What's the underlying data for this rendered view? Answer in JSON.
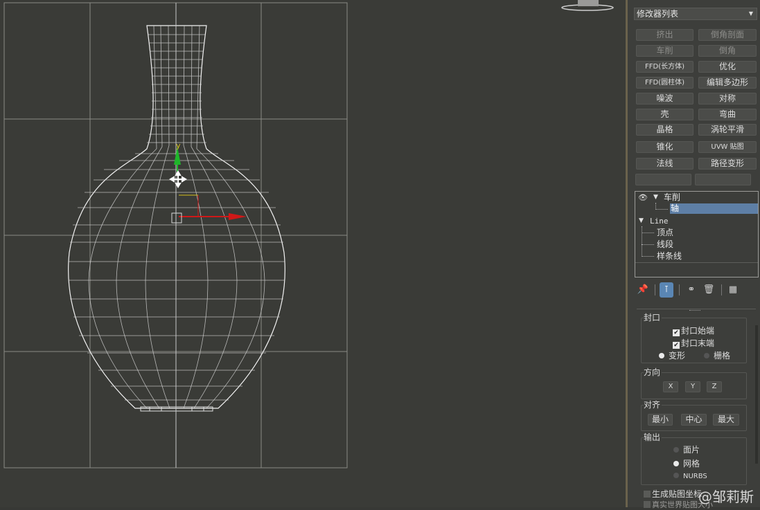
{
  "viewport": {
    "axis_y_label": "y"
  },
  "modifier_list": {
    "label": "修改器列表",
    "buttons": [
      {
        "label": "挤出",
        "dim": true
      },
      {
        "label": "倒角剖面",
        "dim": true
      },
      {
        "label": "车削",
        "dim": true
      },
      {
        "label": "倒角",
        "dim": true
      },
      {
        "label": "FFD(长方体)",
        "dim": false
      },
      {
        "label": "优化",
        "dim": false
      },
      {
        "label": "FFD(圆柱体)",
        "dim": false
      },
      {
        "label": "编辑多边形",
        "dim": false
      },
      {
        "label": "噪波",
        "dim": false
      },
      {
        "label": "对称",
        "dim": false
      },
      {
        "label": "壳",
        "dim": false
      },
      {
        "label": "弯曲",
        "dim": false
      },
      {
        "label": "晶格",
        "dim": false
      },
      {
        "label": "涡轮平滑",
        "dim": false
      },
      {
        "label": "锥化",
        "dim": false
      },
      {
        "label": "UVW 贴图",
        "dim": false
      },
      {
        "label": "法线",
        "dim": false
      },
      {
        "label": "路径变形",
        "dim": false
      }
    ]
  },
  "stack": {
    "modifier": "车削",
    "sub_axis": "轴",
    "base": "Line",
    "sub_items": [
      "顶点",
      "线段",
      "样条线"
    ]
  },
  "caps": {
    "title": "封口",
    "cap_start": "封口始端",
    "cap_end": "封口末端",
    "morph": "变形",
    "grid": "栅格"
  },
  "direction": {
    "title": "方向",
    "x": "X",
    "y": "Y",
    "z": "Z"
  },
  "align": {
    "title": "对齐",
    "min": "最小",
    "center": "中心",
    "max": "最大"
  },
  "output": {
    "title": "输出",
    "patch": "面片",
    "mesh": "网格",
    "nurbs": "NURBS"
  },
  "bottom": {
    "gen_mapping": "生成贴图坐标",
    "real_world": "真实世界贴图大小"
  },
  "watermark": "@邹莉斯"
}
